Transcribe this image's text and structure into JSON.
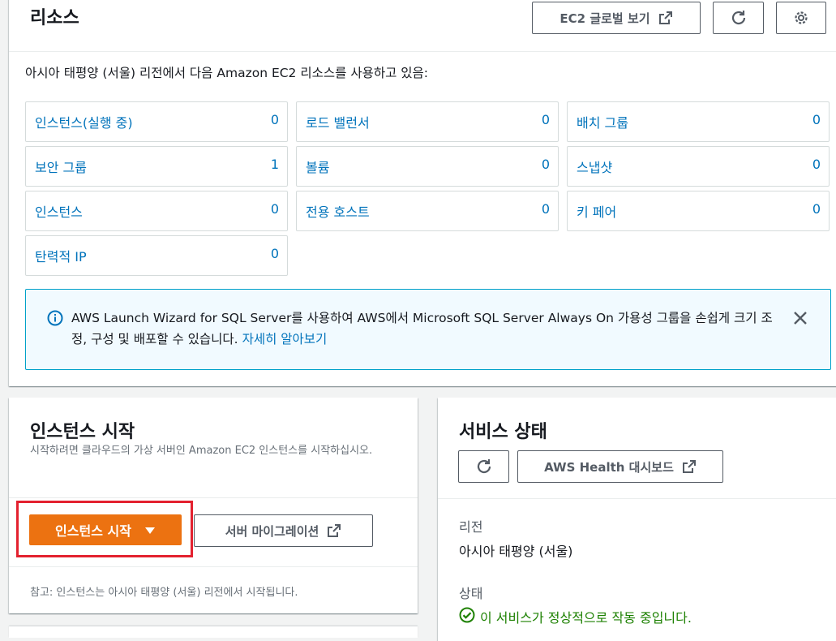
{
  "resources": {
    "title": "리소스",
    "global_view_label": "EC2 글로벌 보기",
    "description": "아시아 태평양 (서울) 리전에서 다음 Amazon EC2 리소스를 사용하고 있음:",
    "cells": [
      {
        "label": "인스턴스(실행 중)",
        "value": "0"
      },
      {
        "label": "로드 밸런서",
        "value": "0"
      },
      {
        "label": "배치 그룹",
        "value": "0"
      },
      {
        "label": "보안 그룹",
        "value": "1"
      },
      {
        "label": "볼륨",
        "value": "0"
      },
      {
        "label": "스냅샷",
        "value": "0"
      },
      {
        "label": "인스턴스",
        "value": "0"
      },
      {
        "label": "전용 호스트",
        "value": "0"
      },
      {
        "label": "키 페어",
        "value": "0"
      },
      {
        "label": "탄력적 IP",
        "value": "0"
      }
    ],
    "info": {
      "text": "AWS Launch Wizard for SQL Server를 사용하여 AWS에서 Microsoft SQL Server Always On 가용성 그룹을 손쉽게 크기 조정, 구성 및 배포할 수 있습니다.",
      "link": "자세히 알아보기"
    }
  },
  "launch": {
    "title": "인스턴스 시작",
    "description": "시작하려면 클라우드의 가상 서버인 Amazon EC2 인스턴스를 시작하십시오.",
    "launch_button": "인스턴스 시작",
    "migrate_button": "서버 마이그레이션",
    "note": "참고: 인스턴스는 아시아 태평양 (서울) 리전에서 시작됩니다."
  },
  "health": {
    "title": "서비스 상태",
    "dashboard_button": "AWS Health 대시보드",
    "region_label": "리전",
    "region_value": "아시아 태평양 (서울)",
    "status_label": "상태",
    "status_value": "이 서비스가 정상적으로 작동 중입니다."
  },
  "colors": {
    "accent_orange": "#ec7211",
    "link_blue": "#0073bb",
    "success_green": "#1d8102",
    "highlight_red": "#e3212f"
  }
}
